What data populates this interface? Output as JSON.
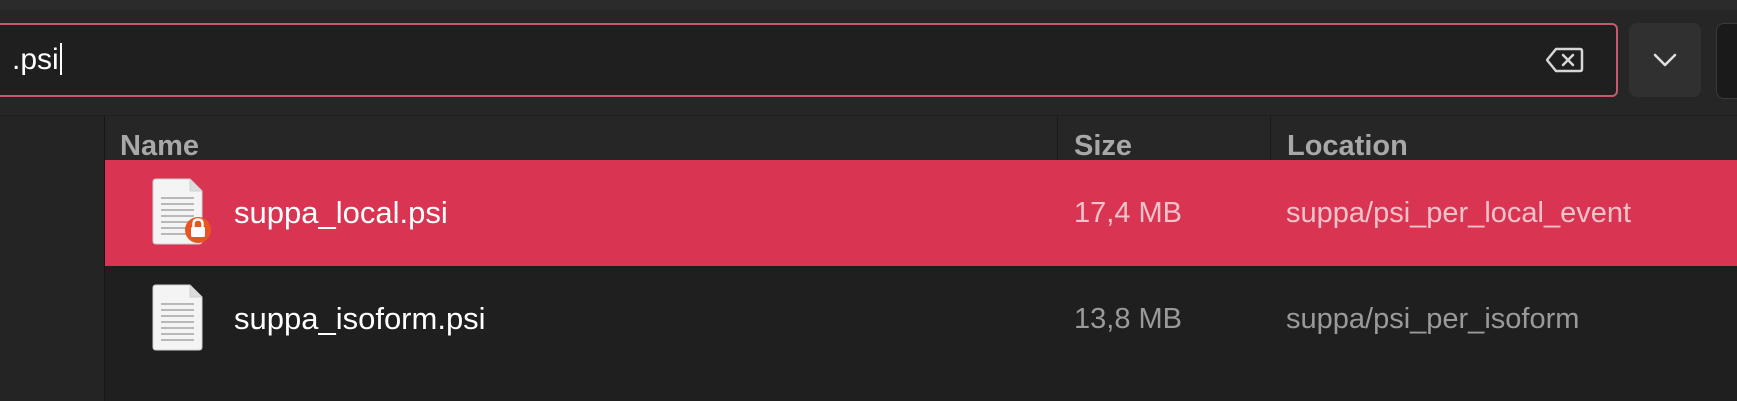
{
  "search": {
    "value": ".psi",
    "clear_icon": "backspace-clear-icon",
    "dropdown_icon": "chevron-down-icon"
  },
  "columns": {
    "name": "Name",
    "size": "Size",
    "location": "Location"
  },
  "results": [
    {
      "name": "suppa_local.psi",
      "size": "17,4 MB",
      "location": "suppa/psi_per_local_event",
      "selected": true,
      "icon": "text-file-icon",
      "badge": "lock-icon"
    },
    {
      "name": "suppa_isoform.psi",
      "size": "13,8 MB",
      "location": "suppa/psi_per_isoform",
      "selected": false,
      "icon": "text-file-icon"
    }
  ],
  "colors": {
    "accent": "#d93451",
    "focus_border": "#c65a6c",
    "lock_badge": "#e95420"
  }
}
